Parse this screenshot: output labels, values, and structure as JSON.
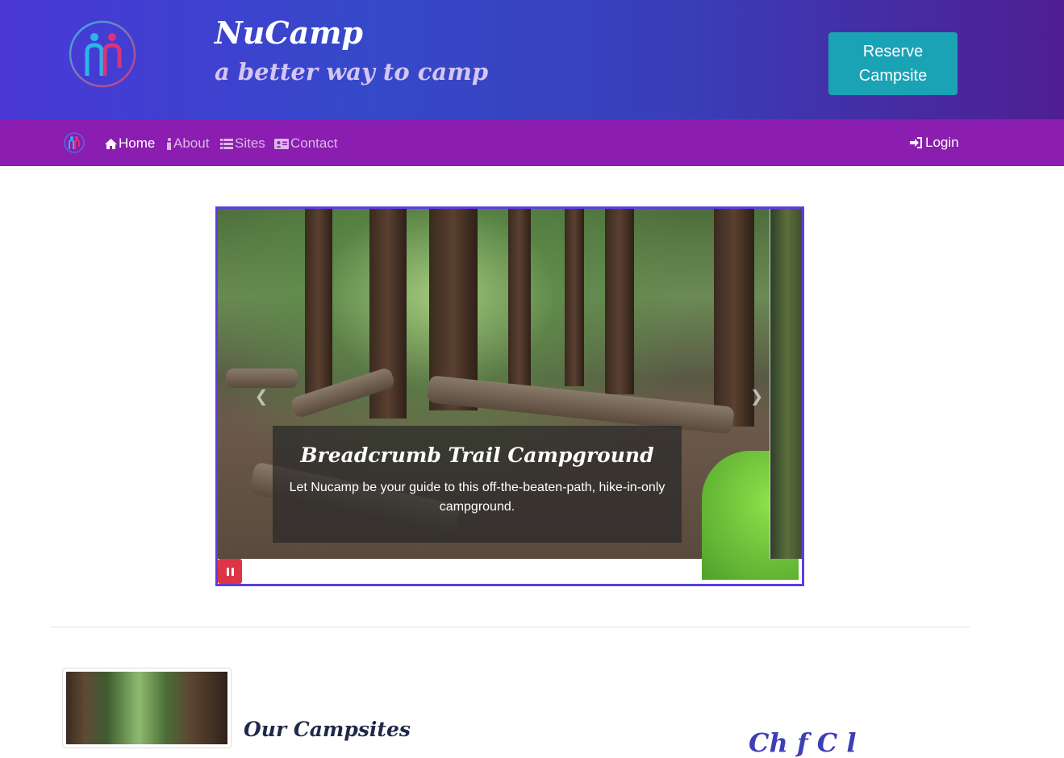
{
  "header": {
    "title": "NuCamp",
    "subtitle": "a better way to camp",
    "reserve_label": "Reserve Campsite"
  },
  "navbar": {
    "items": [
      {
        "label": "Home",
        "icon": "home-icon",
        "active": true
      },
      {
        "label": "About",
        "icon": "info-icon",
        "active": false
      },
      {
        "label": "Sites",
        "icon": "list-icon",
        "active": false
      },
      {
        "label": "Contact",
        "icon": "address-card-icon",
        "active": false
      }
    ],
    "login_label": "Login"
  },
  "carousel": {
    "caption_title": "Breadcrumb Trail Campground",
    "caption_text": "Let Nucamp be your guide to this off-the-beaten-path, hike-in-only campground."
  },
  "content": {
    "section_title": "Our Campsites",
    "partial_heading": "Ch     f C  l"
  },
  "colors": {
    "header_gradient_start": "#4a38d6",
    "header_gradient_end": "#4f1e92",
    "navbar_bg": "#8c1db1",
    "reserve_bg": "#1aa2b5",
    "carousel_border": "#5b3ee0",
    "pause_bg": "#dc3545"
  }
}
